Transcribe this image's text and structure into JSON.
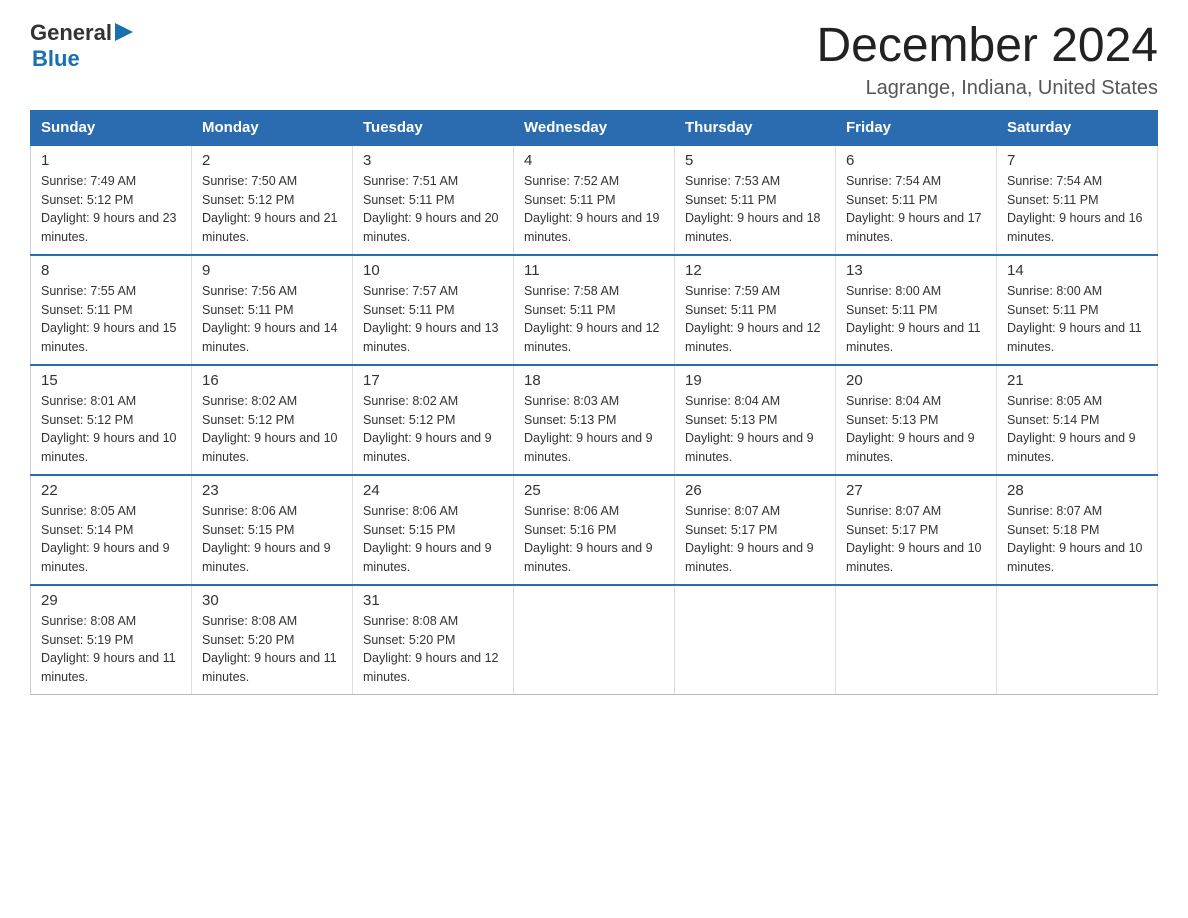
{
  "header": {
    "logo": {
      "general": "General",
      "blue": "Blue",
      "triangle": "▶"
    },
    "title": "December 2024",
    "location": "Lagrange, Indiana, United States"
  },
  "days_of_week": [
    "Sunday",
    "Monday",
    "Tuesday",
    "Wednesday",
    "Thursday",
    "Friday",
    "Saturday"
  ],
  "weeks": [
    [
      {
        "day": "1",
        "sunrise": "Sunrise: 7:49 AM",
        "sunset": "Sunset: 5:12 PM",
        "daylight": "Daylight: 9 hours and 23 minutes."
      },
      {
        "day": "2",
        "sunrise": "Sunrise: 7:50 AM",
        "sunset": "Sunset: 5:12 PM",
        "daylight": "Daylight: 9 hours and 21 minutes."
      },
      {
        "day": "3",
        "sunrise": "Sunrise: 7:51 AM",
        "sunset": "Sunset: 5:11 PM",
        "daylight": "Daylight: 9 hours and 20 minutes."
      },
      {
        "day": "4",
        "sunrise": "Sunrise: 7:52 AM",
        "sunset": "Sunset: 5:11 PM",
        "daylight": "Daylight: 9 hours and 19 minutes."
      },
      {
        "day": "5",
        "sunrise": "Sunrise: 7:53 AM",
        "sunset": "Sunset: 5:11 PM",
        "daylight": "Daylight: 9 hours and 18 minutes."
      },
      {
        "day": "6",
        "sunrise": "Sunrise: 7:54 AM",
        "sunset": "Sunset: 5:11 PM",
        "daylight": "Daylight: 9 hours and 17 minutes."
      },
      {
        "day": "7",
        "sunrise": "Sunrise: 7:54 AM",
        "sunset": "Sunset: 5:11 PM",
        "daylight": "Daylight: 9 hours and 16 minutes."
      }
    ],
    [
      {
        "day": "8",
        "sunrise": "Sunrise: 7:55 AM",
        "sunset": "Sunset: 5:11 PM",
        "daylight": "Daylight: 9 hours and 15 minutes."
      },
      {
        "day": "9",
        "sunrise": "Sunrise: 7:56 AM",
        "sunset": "Sunset: 5:11 PM",
        "daylight": "Daylight: 9 hours and 14 minutes."
      },
      {
        "day": "10",
        "sunrise": "Sunrise: 7:57 AM",
        "sunset": "Sunset: 5:11 PM",
        "daylight": "Daylight: 9 hours and 13 minutes."
      },
      {
        "day": "11",
        "sunrise": "Sunrise: 7:58 AM",
        "sunset": "Sunset: 5:11 PM",
        "daylight": "Daylight: 9 hours and 12 minutes."
      },
      {
        "day": "12",
        "sunrise": "Sunrise: 7:59 AM",
        "sunset": "Sunset: 5:11 PM",
        "daylight": "Daylight: 9 hours and 12 minutes."
      },
      {
        "day": "13",
        "sunrise": "Sunrise: 8:00 AM",
        "sunset": "Sunset: 5:11 PM",
        "daylight": "Daylight: 9 hours and 11 minutes."
      },
      {
        "day": "14",
        "sunrise": "Sunrise: 8:00 AM",
        "sunset": "Sunset: 5:11 PM",
        "daylight": "Daylight: 9 hours and 11 minutes."
      }
    ],
    [
      {
        "day": "15",
        "sunrise": "Sunrise: 8:01 AM",
        "sunset": "Sunset: 5:12 PM",
        "daylight": "Daylight: 9 hours and 10 minutes."
      },
      {
        "day": "16",
        "sunrise": "Sunrise: 8:02 AM",
        "sunset": "Sunset: 5:12 PM",
        "daylight": "Daylight: 9 hours and 10 minutes."
      },
      {
        "day": "17",
        "sunrise": "Sunrise: 8:02 AM",
        "sunset": "Sunset: 5:12 PM",
        "daylight": "Daylight: 9 hours and 9 minutes."
      },
      {
        "day": "18",
        "sunrise": "Sunrise: 8:03 AM",
        "sunset": "Sunset: 5:13 PM",
        "daylight": "Daylight: 9 hours and 9 minutes."
      },
      {
        "day": "19",
        "sunrise": "Sunrise: 8:04 AM",
        "sunset": "Sunset: 5:13 PM",
        "daylight": "Daylight: 9 hours and 9 minutes."
      },
      {
        "day": "20",
        "sunrise": "Sunrise: 8:04 AM",
        "sunset": "Sunset: 5:13 PM",
        "daylight": "Daylight: 9 hours and 9 minutes."
      },
      {
        "day": "21",
        "sunrise": "Sunrise: 8:05 AM",
        "sunset": "Sunset: 5:14 PM",
        "daylight": "Daylight: 9 hours and 9 minutes."
      }
    ],
    [
      {
        "day": "22",
        "sunrise": "Sunrise: 8:05 AM",
        "sunset": "Sunset: 5:14 PM",
        "daylight": "Daylight: 9 hours and 9 minutes."
      },
      {
        "day": "23",
        "sunrise": "Sunrise: 8:06 AM",
        "sunset": "Sunset: 5:15 PM",
        "daylight": "Daylight: 9 hours and 9 minutes."
      },
      {
        "day": "24",
        "sunrise": "Sunrise: 8:06 AM",
        "sunset": "Sunset: 5:15 PM",
        "daylight": "Daylight: 9 hours and 9 minutes."
      },
      {
        "day": "25",
        "sunrise": "Sunrise: 8:06 AM",
        "sunset": "Sunset: 5:16 PM",
        "daylight": "Daylight: 9 hours and 9 minutes."
      },
      {
        "day": "26",
        "sunrise": "Sunrise: 8:07 AM",
        "sunset": "Sunset: 5:17 PM",
        "daylight": "Daylight: 9 hours and 9 minutes."
      },
      {
        "day": "27",
        "sunrise": "Sunrise: 8:07 AM",
        "sunset": "Sunset: 5:17 PM",
        "daylight": "Daylight: 9 hours and 10 minutes."
      },
      {
        "day": "28",
        "sunrise": "Sunrise: 8:07 AM",
        "sunset": "Sunset: 5:18 PM",
        "daylight": "Daylight: 9 hours and 10 minutes."
      }
    ],
    [
      {
        "day": "29",
        "sunrise": "Sunrise: 8:08 AM",
        "sunset": "Sunset: 5:19 PM",
        "daylight": "Daylight: 9 hours and 11 minutes."
      },
      {
        "day": "30",
        "sunrise": "Sunrise: 8:08 AM",
        "sunset": "Sunset: 5:20 PM",
        "daylight": "Daylight: 9 hours and 11 minutes."
      },
      {
        "day": "31",
        "sunrise": "Sunrise: 8:08 AM",
        "sunset": "Sunset: 5:20 PM",
        "daylight": "Daylight: 9 hours and 12 minutes."
      },
      null,
      null,
      null,
      null
    ]
  ]
}
